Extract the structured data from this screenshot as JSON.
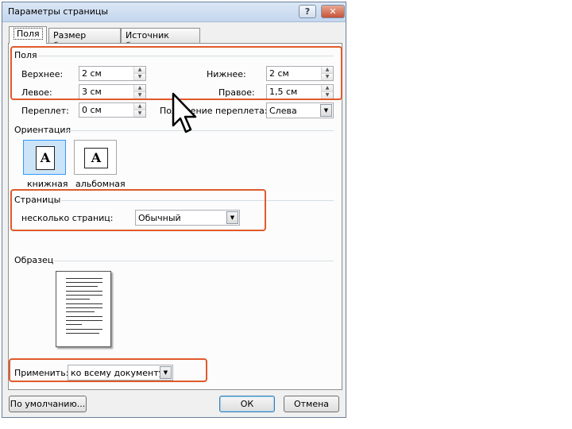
{
  "dialog": {
    "title": "Параметры страницы",
    "help": "?",
    "close": "✕"
  },
  "tabs": [
    "Поля",
    "Размер бумаги",
    "Источник бумаги"
  ],
  "margins": {
    "heading": "Поля",
    "top_label": "Верхнее:",
    "top_value": "2 см",
    "bottom_label": "Нижнее:",
    "bottom_value": "2 см",
    "left_label": "Левое:",
    "left_value": "3 см",
    "right_label": "Правое:",
    "right_value": "1,5 см",
    "gutter_label": "Переплет:",
    "gutter_value": "0 см",
    "gutter_pos_label": "Положение переплета:",
    "gutter_pos_value": "Слева"
  },
  "orientation": {
    "heading": "Ориентация",
    "portrait": "книжная",
    "landscape": "альбомная",
    "glyph": "A"
  },
  "pages": {
    "heading": "Страницы",
    "multiple_label": "несколько страниц:",
    "multiple_value": "Обычный"
  },
  "preview": {
    "heading": "Образец"
  },
  "apply": {
    "label": "Применить:",
    "value": "ко всему документу"
  },
  "buttons": {
    "default": "По умолчанию...",
    "ok": "ОК",
    "cancel": "Отмена"
  },
  "colors": {
    "highlight": "#e05a2a",
    "selected_orientation": "#cce4f7"
  },
  "icons": {
    "cursor": "mouse-pointer-icon",
    "spin_up": "▲",
    "spin_down": "▼",
    "dropdown": "▼"
  }
}
